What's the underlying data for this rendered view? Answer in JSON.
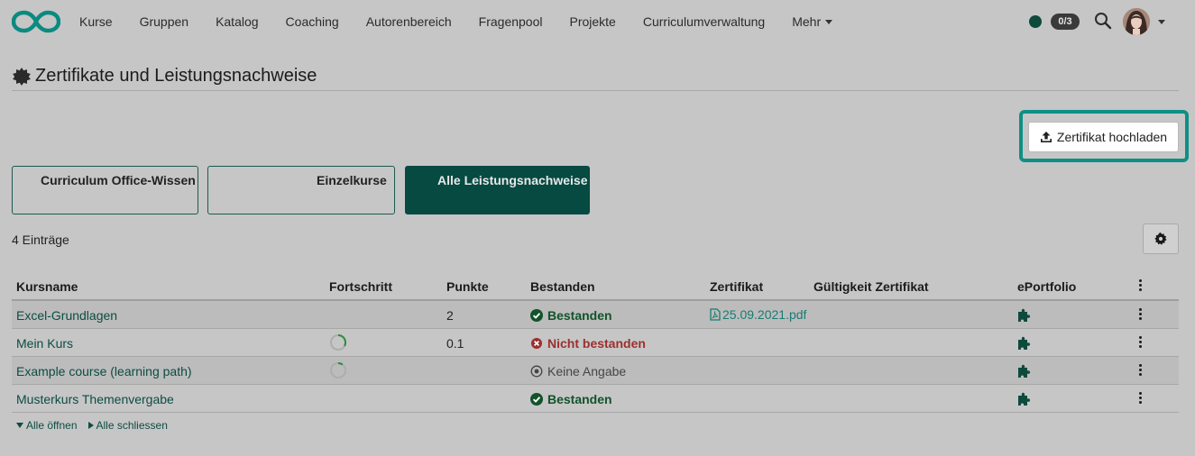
{
  "nav": {
    "items": [
      {
        "label": "Kurse"
      },
      {
        "label": "Gruppen"
      },
      {
        "label": "Katalog"
      },
      {
        "label": "Coaching"
      },
      {
        "label": "Autorenbereich"
      },
      {
        "label": "Fragenpool"
      },
      {
        "label": "Projekte"
      },
      {
        "label": "Curriculumverwaltung"
      }
    ],
    "more_label": "Mehr",
    "badge_count": "0/3",
    "logo_icon": "infinity-logo-icon",
    "status_color": "#0e4a3c"
  },
  "page": {
    "title": "Zertifikate und Leistungsnachweise",
    "title_icon": "gear-badge-icon",
    "upload_label": "Zertifikat hochladen",
    "highlight_color": "#0f8f86"
  },
  "tiles": [
    {
      "label": "Curriculum Office-Wissen",
      "active": false
    },
    {
      "label": "Einzelkurse",
      "active": false
    },
    {
      "label": "Alle Leistungsnachweise",
      "active": true
    }
  ],
  "table": {
    "entries_label": "4 Einträge",
    "columns": {
      "course": "Kursname",
      "progress": "Fortschritt",
      "points": "Punkte",
      "passed": "Bestanden",
      "certificate": "Zertifikat",
      "validity": "Gültigkeit Zertifikat",
      "eportfolio": "ePortfolio"
    },
    "rows": [
      {
        "course": "Excel-Grundlagen",
        "progress": null,
        "points": "2",
        "status": "Bestanden",
        "status_type": "pass",
        "certificate": "25.09.2021.pdf",
        "validity": ""
      },
      {
        "course": "Mein Kurs",
        "progress": 0.33,
        "points": "0.1",
        "status": "Nicht bestanden",
        "status_type": "fail",
        "certificate": "",
        "validity": ""
      },
      {
        "course": "Example course (learning path)",
        "progress": 0.1,
        "points": "",
        "status": "Keine Angabe",
        "status_type": "none",
        "certificate": "",
        "validity": ""
      },
      {
        "course": "Musterkurs Themenvergabe",
        "progress": null,
        "points": "",
        "status": "Bestanden",
        "status_type": "pass",
        "certificate": "",
        "validity": ""
      }
    ],
    "expand_all": "Alle öffnen",
    "collapse_all": "Alle schliessen"
  }
}
